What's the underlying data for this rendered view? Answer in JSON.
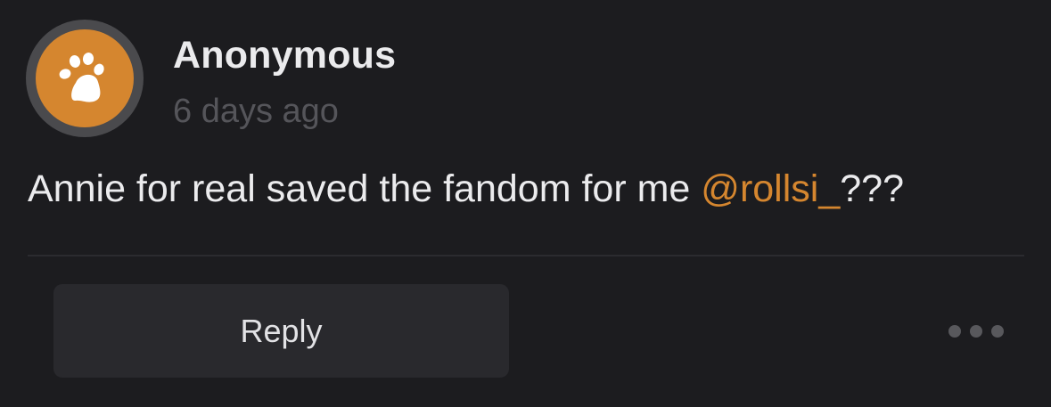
{
  "comment": {
    "author": "Anonymous",
    "timestamp": "6 days ago",
    "text_before": "Annie for real saved the fandom for me ",
    "mention": "@rollsi_",
    "text_after": "???",
    "avatar_icon": "paw-icon"
  },
  "actions": {
    "reply_label": "Reply",
    "more_icon": "more-options-icon"
  },
  "colors": {
    "background": "#1c1c1f",
    "accent": "#d5862f",
    "avatar_ring": "#4a4a4d",
    "button_bg": "#29292d",
    "text": "#ebebed",
    "muted_text": "#55555a"
  }
}
